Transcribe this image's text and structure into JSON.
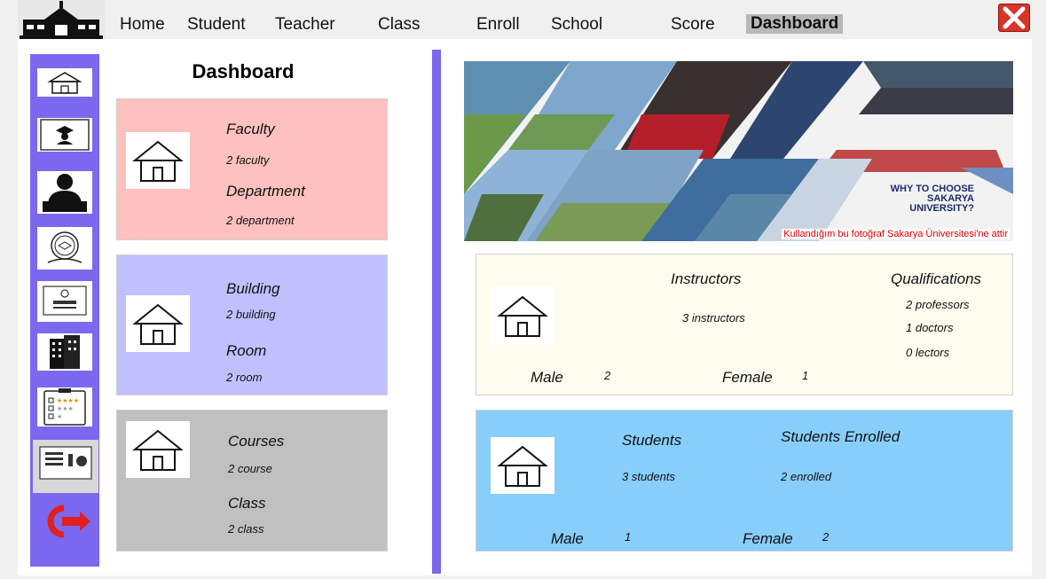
{
  "nav": {
    "items": [
      "Home",
      "Student",
      "Teacher",
      "Class",
      "Enroll",
      "School",
      "Score",
      "Dashboard"
    ],
    "active": "Dashboard"
  },
  "dashboard": {
    "title": "Dashboard",
    "faculty_label": "Faculty",
    "faculty_value": "2 faculty",
    "department_label": "Department",
    "department_value": "2 department",
    "building_label": "Building",
    "building_value": "2 building",
    "room_label": "Room",
    "room_value": "2 room",
    "courses_label": "Courses",
    "courses_value": "2 course",
    "class_label": "Class",
    "class_value": "2 class"
  },
  "banner": {
    "headline": "WHY TO CHOOSE SAKARYA UNIVERSITY?",
    "credit": "Kullandığım bu fotoğraf Sakarya Üniversitesi'ne attir"
  },
  "instructors": {
    "label": "Instructors",
    "value": "3 instructors",
    "qual_label": "Qualifications",
    "professors": "2 professors",
    "doctors": "1 doctors",
    "lectors": "0 lectors",
    "male_label": "Male",
    "male_value": "2",
    "female_label": "Female",
    "female_value": "1"
  },
  "students": {
    "label": "Students",
    "value": "3 students",
    "enrolled_label": "Students Enrolled",
    "enrolled_value": "2 enrolled",
    "male_label": "Male",
    "male_value": "1",
    "female_label": "Female",
    "female_value": "2"
  },
  "colors": {
    "accent": "#7b68ee",
    "faculty_card": "#ffc0c0",
    "building_card": "#c0c0ff",
    "courses_card": "#c0c0c0",
    "instructors_card": "#fdfdef",
    "students_card": "#87cefa"
  },
  "icons": [
    "school-logo-icon",
    "close-icon",
    "home-icon",
    "graduate-icon",
    "teacher-icon",
    "class-icon",
    "enroll-icon",
    "building-icon",
    "score-icon",
    "dashboard-icon",
    "logout-icon",
    "house-icon"
  ]
}
